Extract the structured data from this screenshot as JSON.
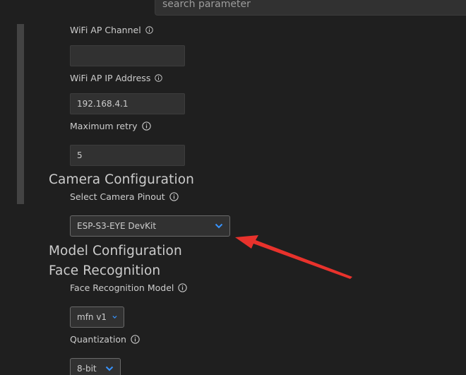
{
  "search": {
    "placeholder": "search parameter"
  },
  "fields": {
    "wifi_ap_channel": {
      "label": "WiFi AP Channel",
      "value": ""
    },
    "wifi_ap_ip": {
      "label": "WiFi AP IP Address",
      "value": "192.168.4.1"
    },
    "max_retry": {
      "label": "Maximum retry",
      "value": "5"
    }
  },
  "camera": {
    "title": "Camera Configuration",
    "pinout_label": "Select Camera Pinout",
    "pinout_value": "ESP-S3-EYE DevKit"
  },
  "model": {
    "title": "Model Configuration",
    "face_title": "Face Recognition",
    "face_model_label": "Face Recognition Model",
    "face_model_value": "mfn v1",
    "quant_label": "Quantization",
    "quant_value": "8-bit"
  },
  "colors": {
    "background": "#1f1f1f",
    "chevron": "#3794ff",
    "annotation_arrow": "#e8322c"
  }
}
